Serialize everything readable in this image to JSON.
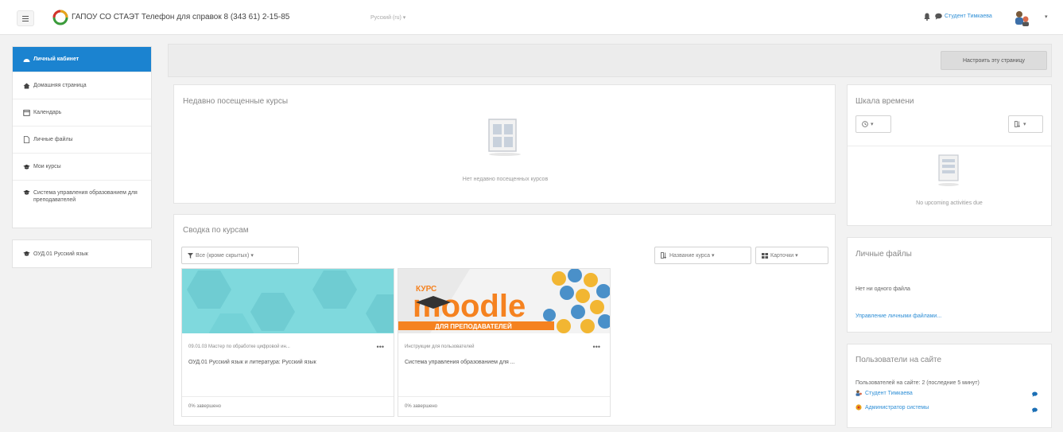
{
  "header": {
    "site_title": "ГАПОУ СО СТАЭТ Телефон для справок 8 (343 61) 2-15-85",
    "language": "Русский (ru) ▾",
    "user_name": "Студент Тимкаева",
    "user_caret": "▾"
  },
  "drawer": {
    "group1": [
      {
        "label": "Личный кабинет",
        "icon": "dashboard-icon"
      },
      {
        "label": "Домашняя страница",
        "icon": "home-icon"
      },
      {
        "label": "Календарь",
        "icon": "calendar-icon"
      },
      {
        "label": "Личные файлы",
        "icon": "file-icon"
      },
      {
        "label": "Мои курсы",
        "icon": "graduation-cap-icon"
      },
      {
        "label": "Система управления образованием для преподавателей",
        "icon": "graduation-cap-icon"
      }
    ],
    "group2": [
      {
        "label": "ОУД.01 Русский язык",
        "icon": "graduation-cap-icon"
      }
    ]
  },
  "page": {
    "customise_button": "Настроить эту страницу"
  },
  "recent_courses": {
    "title": "Недавно посещенные курсы",
    "empty_text": "Нет недавно посещенных курсов"
  },
  "course_overview": {
    "title": "Сводка по курсам",
    "filter_button": "Все (кроме скрытых) ▾",
    "sort_button": "Название курса ▾",
    "view_button": "Карточки ▾",
    "courses": [
      {
        "category": "09.01.03 Мастер по обработке цифровой ин...",
        "name": "ОУД.01 Русский язык и литература: Русский язык",
        "progress": "0% завершено"
      },
      {
        "category": "Инструкции для пользователей",
        "name": "Система управления образованием для ...",
        "progress": "0% завершено",
        "image_text_top": "КУРС",
        "image_text_main": "moodle",
        "image_text_bottom": "ДЛЯ ПРЕПОДАВАТЕЛЕЙ"
      }
    ]
  },
  "timeline": {
    "title": "Шкала времени",
    "empty_text": "No upcoming activities due"
  },
  "private_files": {
    "title": "Личные файлы",
    "empty_text": "Нет ни одного файла",
    "manage_link": "Управление личными файлами..."
  },
  "online_users": {
    "title": "Пользователи на сайте",
    "summary": "Пользователей на сайте: 2 (последние 5 минут)",
    "users": [
      "Студент Тимкаева",
      "Администратор системы"
    ]
  },
  "colors": {
    "accent": "#1b83d0",
    "link": "#2f8fd6",
    "page_bg": "#f2f2f2"
  }
}
